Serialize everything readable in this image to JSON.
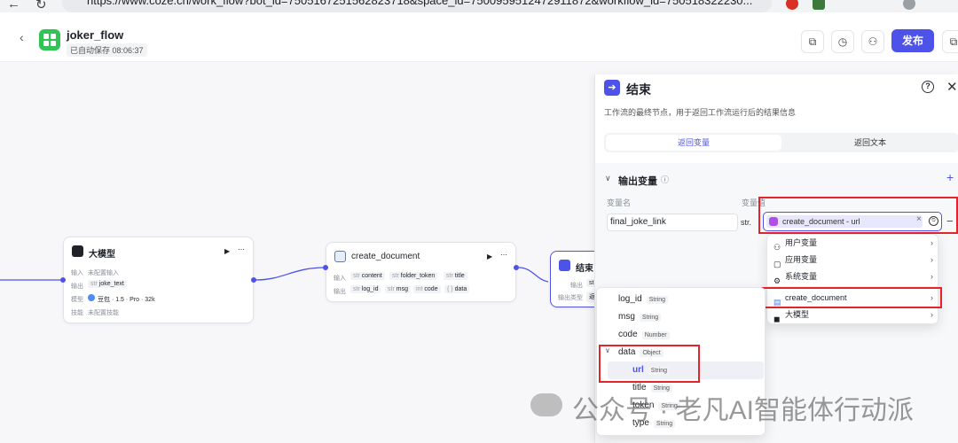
{
  "browser": {
    "url": "https://www.coze.cn/work_flow?bot_id=7505167251562823718&space_id=7500959512472911872&workflow_id=750518322230..."
  },
  "header": {
    "app_name": "joker_flow",
    "autosave": "已自动保存 08:06:37",
    "publish": "发布"
  },
  "nodes": {
    "llm": {
      "title": "大模型",
      "input_label": "输入",
      "input_value": "未配置输入",
      "output_label": "输出",
      "output_type": "str",
      "output_value": "joke_text",
      "model_label": "模型",
      "model_value": "豆包 · 1.5 · Pro · 32k",
      "skill_label": "技能",
      "skill_value": "未配置技能"
    },
    "create_doc": {
      "title": "create_document",
      "input_label": "输入",
      "inputs": [
        {
          "type": "str",
          "name": "content"
        },
        {
          "type": "str",
          "name": "folder_token"
        },
        {
          "type": "str",
          "name": "title"
        }
      ],
      "output_label": "输出",
      "outputs": [
        {
          "type": "str",
          "name": "log_id"
        },
        {
          "type": "str",
          "name": "msg"
        },
        {
          "type": "int",
          "name": "code"
        },
        {
          "type": "{ }",
          "name": "data"
        }
      ]
    },
    "end": {
      "title": "结束",
      "output_label": "输出",
      "output_type_label": "输出类型",
      "output_chip": "st",
      "output_type_value": "返"
    }
  },
  "panel": {
    "title": "结束",
    "description": "工作流的最终节点，用于返回工作流运行后的结果信息",
    "tab_return_var": "返回变量",
    "tab_return_text": "返回文本",
    "section_title": "输出变量",
    "col_name": "变量名",
    "col_value": "变量值",
    "var_name": "final_joke_link",
    "var_type": "str.",
    "ref_value": "create_document - url"
  },
  "dropdown": {
    "items": [
      {
        "icon": "user-icon",
        "label": "用户变量"
      },
      {
        "icon": "app-icon",
        "label": "应用变量"
      },
      {
        "icon": "gear-icon",
        "label": "系统变量"
      },
      {
        "icon": "doc-icon",
        "label": "create_document"
      },
      {
        "icon": "llm-icon",
        "label": "大模型"
      }
    ]
  },
  "submenu": {
    "items": [
      {
        "name": "log_id",
        "type": "String"
      },
      {
        "name": "msg",
        "type": "String"
      },
      {
        "name": "code",
        "type": "Number"
      },
      {
        "name": "data",
        "type": "Object"
      },
      {
        "name": "url",
        "type": "String"
      },
      {
        "name": "title",
        "type": "String"
      },
      {
        "name": "token",
        "type": "String"
      },
      {
        "name": "type",
        "type": "String"
      }
    ]
  },
  "watermark": "公众号 · 老凡AI智能体行动派",
  "colors": {
    "accent": "#4d53e8",
    "highlight": "#e3242b"
  }
}
